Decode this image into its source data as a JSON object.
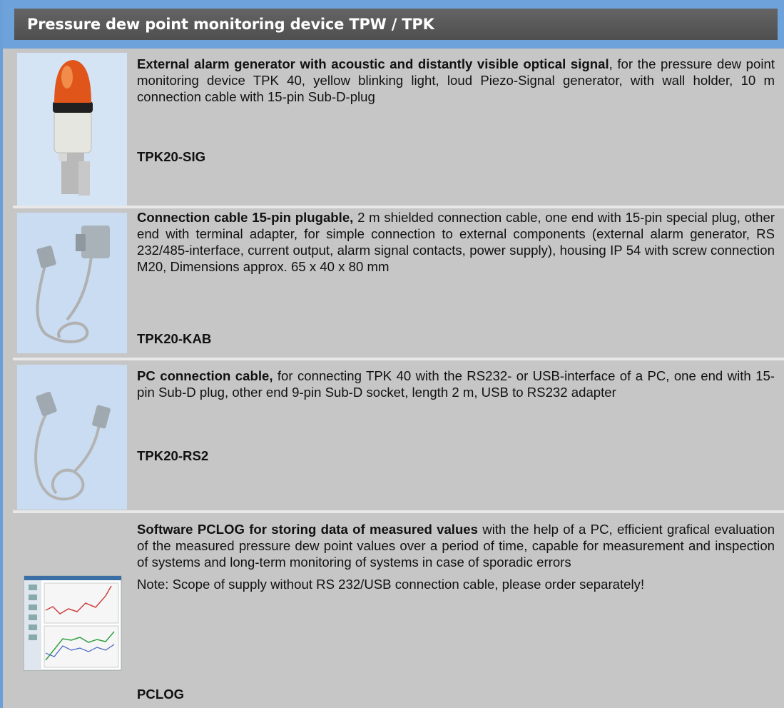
{
  "header": {
    "title": "Pressure dew point monitoring device TPW / TPK"
  },
  "products": [
    {
      "lead": "External alarm generator with acoustic and distantly visible optical signal",
      "text": ", for the pressure dew point monitoring device TPK 40, yellow blinking light, loud Piezo-Signal generator, with wall holder, 10 m connection cable with 15-pin Sub-D-plug",
      "code": "TPK20-SIG",
      "image": "alarm-beacon"
    },
    {
      "lead": "Connection cable 15-pin plugable,",
      "text": " 2 m shielded connection cable, one end with 15-pin special plug, other end with terminal adapter, for simple connection to external components (external alarm generator, RS 232/485-interface, current output, alarm signal contacts, power supply), housing IP 54 with screw connection M20, Dimensions approx. 65 x 40 x 80 mm",
      "code": "TPK20-KAB",
      "image": "cable-with-adapter"
    },
    {
      "lead": "PC connection cable,",
      "text": " for connecting TPK 40 with the RS232- or USB-interface of a PC, one end with 15-pin Sub-D plug, other end 9-pin Sub-D socket, length 2 m, USB to RS232 adapter",
      "code": "TPK20-RS2",
      "image": "pc-cable"
    },
    {
      "lead": "Software PCLOG for storing data of measured values",
      "text": " with the help of a PC, efficient grafical evaluation of the measured pressure dew point values over a period of time, capable for measurement and inspection of systems and long-term monitoring of systems in case of sporadic errors",
      "note": "Note: Scope of supply without RS 232/USB connection cable, please order separately!",
      "code": "PCLOG",
      "image": "software-screenshot"
    }
  ]
}
